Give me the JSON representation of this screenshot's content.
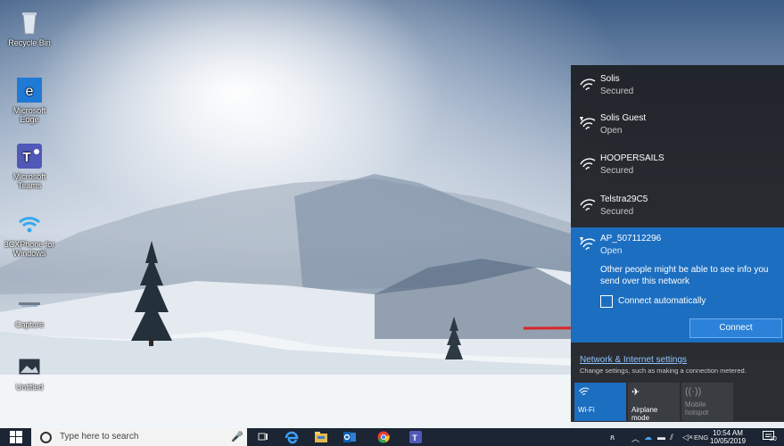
{
  "desktop": {
    "icons": [
      {
        "label": "Recycle Bin",
        "icon": "recycle-bin-icon"
      },
      {
        "label": "Microsoft Edge",
        "icon": "edge-icon"
      },
      {
        "label": "Microsoft Teams",
        "icon": "teams-icon"
      },
      {
        "label": "3CXPhone for Windows",
        "icon": "phone-wifi-icon"
      },
      {
        "label": "Capture",
        "icon": "capture-icon"
      },
      {
        "label": "Untitled",
        "icon": "image-file-icon"
      }
    ]
  },
  "network_flyout": {
    "networks": [
      {
        "name": "Solis",
        "status": "Secured",
        "icon": "wifi-secured-icon"
      },
      {
        "name": "Solis Guest",
        "status": "Open",
        "icon": "wifi-open-icon"
      },
      {
        "name": "HOOPERSAILS",
        "status": "Secured",
        "icon": "wifi-secured-icon"
      },
      {
        "name": "Telstra29C5",
        "status": "Secured",
        "icon": "wifi-secured-icon"
      }
    ],
    "selected": {
      "name": "AP_507112296",
      "status": "Open",
      "warning": "Other people might be able to see info you send over this network",
      "auto_connect_label": "Connect automatically",
      "auto_connect_checked": false,
      "connect_label": "Connect"
    },
    "settings_link": "Network & Internet settings",
    "settings_desc": "Change settings, such as making a connection metered.",
    "quick_actions": [
      {
        "label": "Wi-Fi",
        "active": true,
        "icon": "wifi-icon"
      },
      {
        "label": "Airplane mode",
        "active": false,
        "icon": "airplane-icon"
      },
      {
        "label": "Mobile hotspot",
        "active": false,
        "icon": "hotspot-icon"
      }
    ]
  },
  "taskbar": {
    "search_placeholder": "Type here to search",
    "apps": [
      "task-view-icon",
      "edge-icon",
      "file-explorer-icon",
      "outlook-icon",
      "chrome-icon",
      "teams-icon"
    ],
    "tray_language": "ENG",
    "time": "10:54 AM",
    "date": "10/05/2019",
    "notification_count": "20"
  },
  "colors": {
    "accent": "#1c6ec0",
    "flyout_bg": "#1c1e22",
    "taskbar_bg": "#1b2534",
    "arrow": "#d9262b"
  }
}
